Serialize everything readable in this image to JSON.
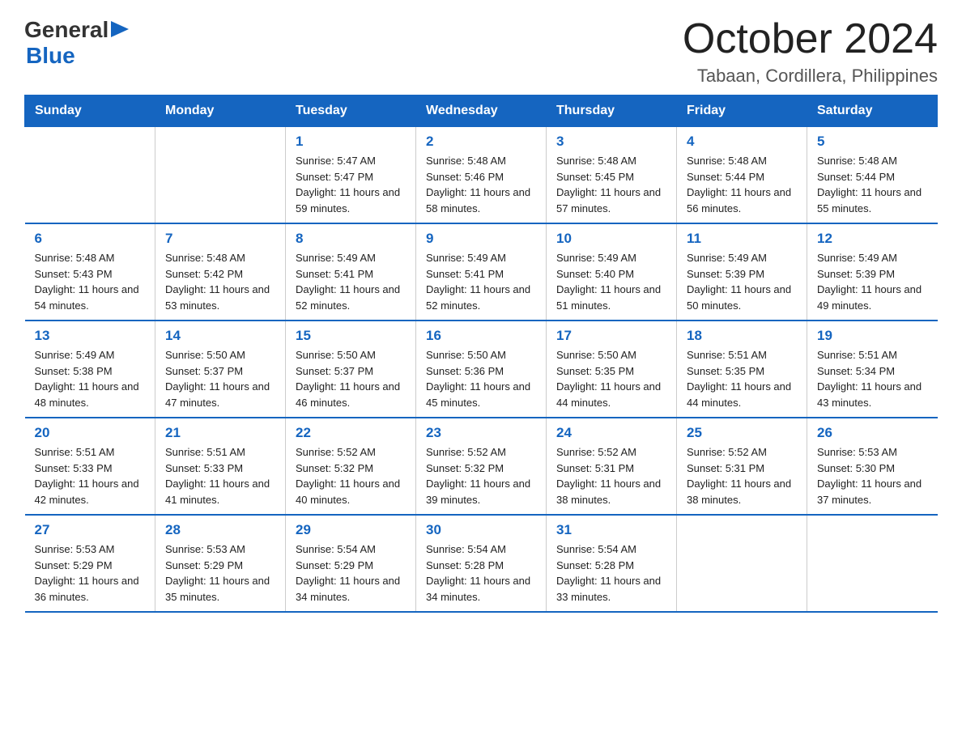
{
  "header": {
    "logo_general": "General",
    "logo_blue": "Blue",
    "month_title": "October 2024",
    "location": "Tabaan, Cordillera, Philippines"
  },
  "days_of_week": [
    "Sunday",
    "Monday",
    "Tuesday",
    "Wednesday",
    "Thursday",
    "Friday",
    "Saturday"
  ],
  "weeks": [
    [
      {
        "day": "",
        "info": ""
      },
      {
        "day": "",
        "info": ""
      },
      {
        "day": "1",
        "sunrise": "5:47 AM",
        "sunset": "5:47 PM",
        "daylight": "11 hours and 59 minutes."
      },
      {
        "day": "2",
        "sunrise": "5:48 AM",
        "sunset": "5:46 PM",
        "daylight": "11 hours and 58 minutes."
      },
      {
        "day": "3",
        "sunrise": "5:48 AM",
        "sunset": "5:45 PM",
        "daylight": "11 hours and 57 minutes."
      },
      {
        "day": "4",
        "sunrise": "5:48 AM",
        "sunset": "5:44 PM",
        "daylight": "11 hours and 56 minutes."
      },
      {
        "day": "5",
        "sunrise": "5:48 AM",
        "sunset": "5:44 PM",
        "daylight": "11 hours and 55 minutes."
      }
    ],
    [
      {
        "day": "6",
        "sunrise": "5:48 AM",
        "sunset": "5:43 PM",
        "daylight": "11 hours and 54 minutes."
      },
      {
        "day": "7",
        "sunrise": "5:48 AM",
        "sunset": "5:42 PM",
        "daylight": "11 hours and 53 minutes."
      },
      {
        "day": "8",
        "sunrise": "5:49 AM",
        "sunset": "5:41 PM",
        "daylight": "11 hours and 52 minutes."
      },
      {
        "day": "9",
        "sunrise": "5:49 AM",
        "sunset": "5:41 PM",
        "daylight": "11 hours and 52 minutes."
      },
      {
        "day": "10",
        "sunrise": "5:49 AM",
        "sunset": "5:40 PM",
        "daylight": "11 hours and 51 minutes."
      },
      {
        "day": "11",
        "sunrise": "5:49 AM",
        "sunset": "5:39 PM",
        "daylight": "11 hours and 50 minutes."
      },
      {
        "day": "12",
        "sunrise": "5:49 AM",
        "sunset": "5:39 PM",
        "daylight": "11 hours and 49 minutes."
      }
    ],
    [
      {
        "day": "13",
        "sunrise": "5:49 AM",
        "sunset": "5:38 PM",
        "daylight": "11 hours and 48 minutes."
      },
      {
        "day": "14",
        "sunrise": "5:50 AM",
        "sunset": "5:37 PM",
        "daylight": "11 hours and 47 minutes."
      },
      {
        "day": "15",
        "sunrise": "5:50 AM",
        "sunset": "5:37 PM",
        "daylight": "11 hours and 46 minutes."
      },
      {
        "day": "16",
        "sunrise": "5:50 AM",
        "sunset": "5:36 PM",
        "daylight": "11 hours and 45 minutes."
      },
      {
        "day": "17",
        "sunrise": "5:50 AM",
        "sunset": "5:35 PM",
        "daylight": "11 hours and 44 minutes."
      },
      {
        "day": "18",
        "sunrise": "5:51 AM",
        "sunset": "5:35 PM",
        "daylight": "11 hours and 44 minutes."
      },
      {
        "day": "19",
        "sunrise": "5:51 AM",
        "sunset": "5:34 PM",
        "daylight": "11 hours and 43 minutes."
      }
    ],
    [
      {
        "day": "20",
        "sunrise": "5:51 AM",
        "sunset": "5:33 PM",
        "daylight": "11 hours and 42 minutes."
      },
      {
        "day": "21",
        "sunrise": "5:51 AM",
        "sunset": "5:33 PM",
        "daylight": "11 hours and 41 minutes."
      },
      {
        "day": "22",
        "sunrise": "5:52 AM",
        "sunset": "5:32 PM",
        "daylight": "11 hours and 40 minutes."
      },
      {
        "day": "23",
        "sunrise": "5:52 AM",
        "sunset": "5:32 PM",
        "daylight": "11 hours and 39 minutes."
      },
      {
        "day": "24",
        "sunrise": "5:52 AM",
        "sunset": "5:31 PM",
        "daylight": "11 hours and 38 minutes."
      },
      {
        "day": "25",
        "sunrise": "5:52 AM",
        "sunset": "5:31 PM",
        "daylight": "11 hours and 38 minutes."
      },
      {
        "day": "26",
        "sunrise": "5:53 AM",
        "sunset": "5:30 PM",
        "daylight": "11 hours and 37 minutes."
      }
    ],
    [
      {
        "day": "27",
        "sunrise": "5:53 AM",
        "sunset": "5:29 PM",
        "daylight": "11 hours and 36 minutes."
      },
      {
        "day": "28",
        "sunrise": "5:53 AM",
        "sunset": "5:29 PM",
        "daylight": "11 hours and 35 minutes."
      },
      {
        "day": "29",
        "sunrise": "5:54 AM",
        "sunset": "5:29 PM",
        "daylight": "11 hours and 34 minutes."
      },
      {
        "day": "30",
        "sunrise": "5:54 AM",
        "sunset": "5:28 PM",
        "daylight": "11 hours and 34 minutes."
      },
      {
        "day": "31",
        "sunrise": "5:54 AM",
        "sunset": "5:28 PM",
        "daylight": "11 hours and 33 minutes."
      },
      {
        "day": "",
        "info": ""
      },
      {
        "day": "",
        "info": ""
      }
    ]
  ],
  "colors": {
    "header_bg": "#1565c0",
    "header_text": "#ffffff",
    "day_number": "#1565c0",
    "border": "#1565c0"
  }
}
